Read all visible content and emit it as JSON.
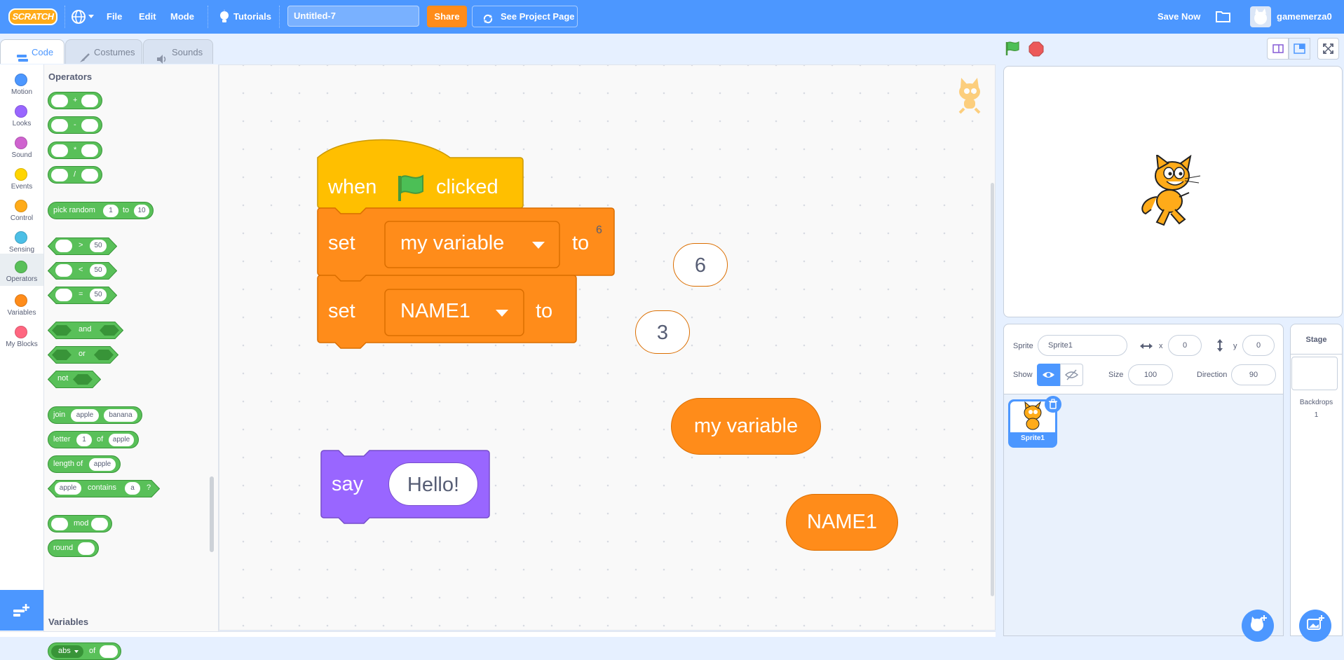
{
  "menubar": {
    "logo": "SCRATCH",
    "file_label": "File",
    "edit_label": "Edit",
    "mode_label": "Mode",
    "tutorials_label": "Tutorials",
    "project_title": "Untitled-7",
    "share_label": "Share",
    "see_project_label": "See Project Page",
    "save_now_label": "Save Now",
    "username": "gamemerza0"
  },
  "tabs": [
    {
      "label": "Code",
      "active": true
    },
    {
      "label": "Costumes",
      "active": false
    },
    {
      "label": "Sounds",
      "active": false
    }
  ],
  "categories": [
    {
      "label": "Motion",
      "color": "#4c97ff"
    },
    {
      "label": "Looks",
      "color": "#9966ff"
    },
    {
      "label": "Sound",
      "color": "#cf63cf"
    },
    {
      "label": "Events",
      "color": "#ffd500"
    },
    {
      "label": "Control",
      "color": "#ffab19"
    },
    {
      "label": "Sensing",
      "color": "#4cbfe6"
    },
    {
      "label": "Operators",
      "color": "#59c059"
    },
    {
      "label": "Variables",
      "color": "#ff8c1a"
    },
    {
      "label": "My Blocks",
      "color": "#ff6680"
    }
  ],
  "palette": {
    "section_title": "Operators",
    "next_section_title": "Variables",
    "add": "+",
    "sub": "-",
    "mul": "*",
    "div": "/",
    "pick_random": "pick random",
    "pick_from": "1",
    "pick_to_word": "to",
    "pick_to": "10",
    "gt": ">",
    "lt": "<",
    "eq": "=",
    "cmp_value": "50",
    "and": "and",
    "or": "or",
    "not": "not",
    "join": "join",
    "join_a": "apple",
    "join_b": "banana",
    "letter": "letter",
    "letter_n": "1",
    "letter_of": "of",
    "letter_str": "apple",
    "length_of": "length of",
    "length_str": "apple",
    "contains_str": "apple",
    "contains": "contains",
    "contains_char": "a",
    "contains_q": "?",
    "mod": "mod",
    "round": "round",
    "abs": "abs",
    "abs_of": "of"
  },
  "script": {
    "hat_when": "when",
    "hat_clicked": "clicked",
    "set1_word": "set",
    "set1_var": "my variable",
    "set1_to": "to",
    "set1_value": "6",
    "set2_word": "set",
    "set2_var": "NAME1",
    "set2_to": "to",
    "set2_value": "3",
    "reporter1": "my variable",
    "reporter2": "NAME1",
    "say_word": "say",
    "say_value": "Hello!"
  },
  "sprite_info": {
    "sprite_label": "Sprite",
    "sprite_name": "Sprite1",
    "x_label": "x",
    "x_value": "0",
    "y_label": "y",
    "y_value": "0",
    "show_label": "Show",
    "size_label": "Size",
    "size_value": "100",
    "direction_label": "Direction",
    "direction_value": "90"
  },
  "sprites": [
    {
      "name": "Sprite1",
      "selected": true
    }
  ],
  "stage_pane": {
    "title": "Stage",
    "backdrops_label": "Backdrops",
    "backdrops_count": "1"
  },
  "colors": {
    "menubar": "#4c97ff",
    "events": "#ffbf00",
    "variables": "#ff8c1a",
    "looks": "#9966ff",
    "operators": "#59c059"
  }
}
